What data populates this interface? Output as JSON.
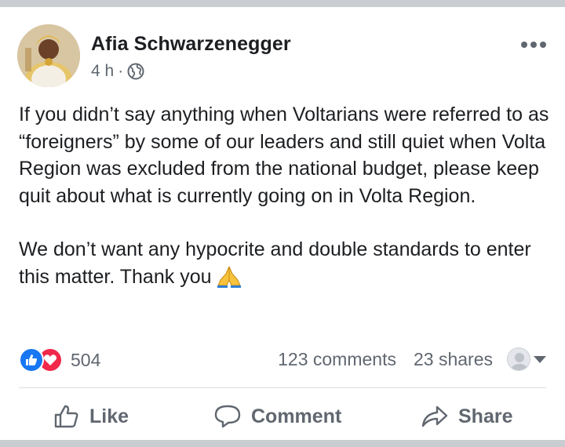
{
  "post": {
    "author": "Afia Schwarzenegger",
    "time": "4 h",
    "separator": "·",
    "privacy_icon": "globe-icon",
    "more_icon": "more-options-icon",
    "paragraphs": [
      "If you didn’t say anything when Voltarians were referred to as “foreigners” by some of our leaders and still quiet when Volta Region was excluded from the national budget, please keep quit about what is currently going on in Volta Region.",
      "We don’t want any hypocrite and double standards to enter this matter. Thank you"
    ],
    "emoji": "folded-hands-emoji"
  },
  "stats": {
    "reaction_count": "504",
    "reactions": [
      "like",
      "love"
    ],
    "comments": "123 comments",
    "shares": "23 shares"
  },
  "actions": {
    "like": "Like",
    "comment": "Comment",
    "share": "Share"
  },
  "colors": {
    "like_blue": "#1877f2",
    "love_red": "#f0284a",
    "secondary_text": "#606770",
    "primary_text": "#1c1e21"
  }
}
